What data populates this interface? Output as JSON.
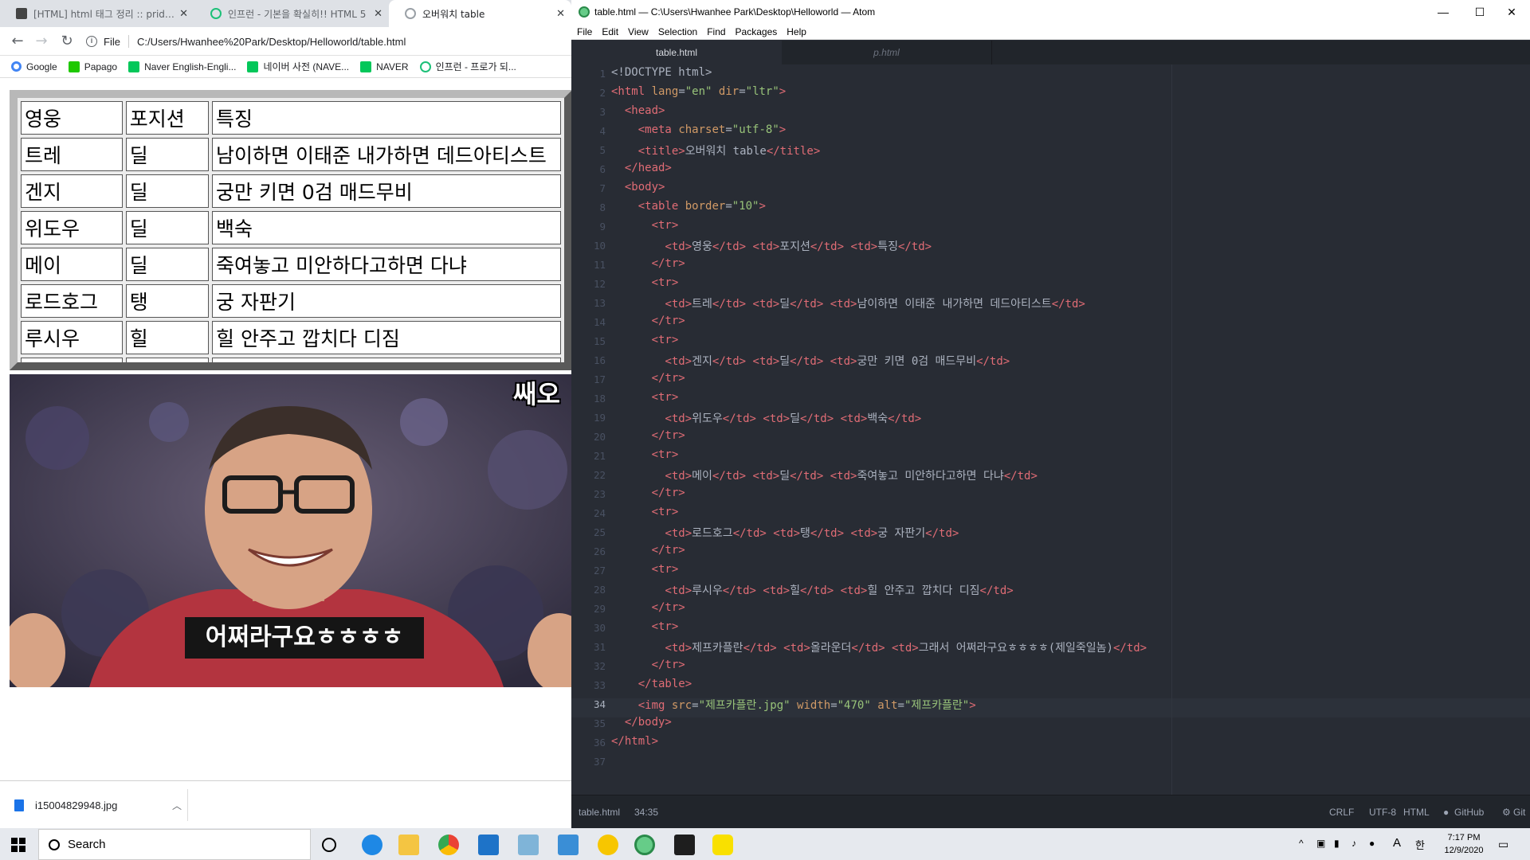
{
  "browser": {
    "tabs": [
      {
        "label": "[HTML] html 태그 정리 :: pridiot",
        "close": "✕"
      },
      {
        "label": "인프런 - 기본을 확실히!! HTML 5",
        "close": "✕"
      },
      {
        "label": "오버워치 table",
        "close": "✕"
      }
    ],
    "address": {
      "scheme": "File",
      "url": "C:/Users/Hwanhee%20Park/Desktop/Helloworld/table.html"
    },
    "bookmarks": [
      {
        "label": "Google",
        "color": "#4285f4"
      },
      {
        "label": "Papago",
        "color": "#1ec800"
      },
      {
        "label": "Naver English-Engli...",
        "color": "#03c75a"
      },
      {
        "label": "네이버 사전 (NAVE...",
        "color": "#03c75a"
      },
      {
        "label": "NAVER",
        "color": "#03c75a"
      },
      {
        "label": "인프런 - 프로가 되...",
        "color": "#1dc078"
      }
    ],
    "table": {
      "rows": [
        [
          "영웅",
          "포지션",
          "특징"
        ],
        [
          "트레",
          "딜",
          "남이하면 이태준 내가하면 데드아티스트"
        ],
        [
          "겐지",
          "딜",
          "궁만 키면 0검 매드무비"
        ],
        [
          "위도우",
          "딜",
          "백숙"
        ],
        [
          "메이",
          "딜",
          "죽여놓고 미안하다고하면 다냐"
        ],
        [
          "로드호그",
          "탱",
          "궁 자판기"
        ],
        [
          "루시우",
          "힐",
          "힐 안주고 깝치다 디짐"
        ],
        [
          "제프카플란",
          "올라운더",
          "그래서 어쩌라구요ㅎㅎㅎㅎ(제일죽일놈)"
        ]
      ]
    },
    "image": {
      "caption": "어쩌라구요ㅎㅎㅎㅎ",
      "corner_text": "쌔오"
    },
    "download": {
      "filename": "i15004829948.jpg"
    }
  },
  "atom": {
    "title": "table.html — C:\\Users\\Hwanhee Park\\Desktop\\Helloworld — Atom",
    "menu": [
      "File",
      "Edit",
      "View",
      "Selection",
      "Find",
      "Packages",
      "Help"
    ],
    "tabs": [
      {
        "label": "table.html"
      },
      {
        "label": "p.html"
      }
    ],
    "current_line": 34,
    "status": {
      "file": "table.html",
      "cursor": "34:35",
      "line_ending": "CRLF",
      "encoding": "UTF-8",
      "grammar": "HTML",
      "github": "GitHub",
      "git": "Git"
    }
  },
  "taskbar": {
    "search_placeholder": "Search",
    "time": "7:17 PM",
    "date": "12/9/2020",
    "lang": "A",
    "ime": "한"
  }
}
